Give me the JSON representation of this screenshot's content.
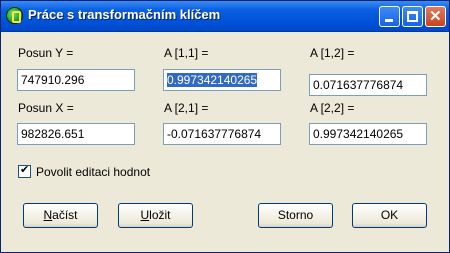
{
  "window": {
    "title": "Práce s transformačním klíčem"
  },
  "fields": {
    "posun_y": {
      "label": "Posun Y =",
      "value": "747910.296"
    },
    "a11": {
      "label": "A [1,1] =",
      "value": "0.997342140265"
    },
    "a12": {
      "label": "A [1,2] =",
      "value": "0.071637776874"
    },
    "posun_x": {
      "label": "Posun X =",
      "value": "982826.651"
    },
    "a21": {
      "label": "A [2,1] =",
      "value": "-0.071637776874"
    },
    "a22": {
      "label": "A [2,2] =",
      "value": "0.997342140265"
    }
  },
  "checkbox": {
    "label": "Povolit editaci hodnot",
    "checked": true
  },
  "buttons": {
    "nacist": {
      "accel": "N",
      "rest": "ačíst"
    },
    "ulozit": {
      "accel": "U",
      "rest": "ložit"
    },
    "storno": "Storno",
    "ok": "OK"
  },
  "icons": [
    "app-icon",
    "minimize-icon",
    "maximize-icon",
    "close-icon",
    "checkmark-icon"
  ],
  "colors": {
    "title_bar": "#0052d8",
    "window_bg": "#ece9d8",
    "selection": "#316ac5",
    "close_button": "#c6441e"
  }
}
